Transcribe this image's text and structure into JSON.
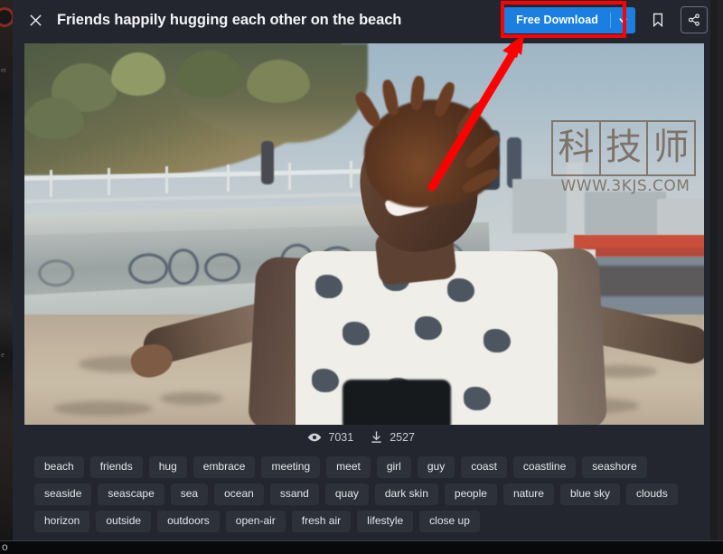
{
  "header": {
    "close_icon": "close-icon",
    "title": "Friends happily hugging each other on the beach",
    "download_label": "Free Download",
    "download_caret_icon": "chevron-down-icon",
    "bookmark_icon": "bookmark-icon",
    "share_icon": "share-icon"
  },
  "photo": {
    "alt": "Man with dreadlocks smiling with arms outstretched on a beach promenade",
    "watermark_chars": [
      "科",
      "技",
      "师"
    ],
    "watermark_url": "WWW.3KJS.COM"
  },
  "annotation": {
    "highlight_color": "#ff0000",
    "arrow_color": "#ff0000",
    "target": "Free Download"
  },
  "stats": {
    "views_icon": "eye-icon",
    "views": "7031",
    "downloads_icon": "download-icon",
    "downloads": "2527"
  },
  "tags": [
    "beach",
    "friends",
    "hug",
    "embrace",
    "meeting",
    "meet",
    "girl",
    "guy",
    "coast",
    "coastline",
    "seashore",
    "seaside",
    "seascape",
    "sea",
    "ocean",
    "ssand",
    "quay",
    "dark skin",
    "people",
    "nature",
    "blue sky",
    "clouds",
    "horizon",
    "outside",
    "outdoors",
    "open-air",
    "fresh air",
    "lifestyle",
    "close up"
  ],
  "backdrop": {
    "left_text_1": "et",
    "left_text_2": "e",
    "bottom_glyph": "o"
  },
  "colors": {
    "modal_bg": "#23262e",
    "accent_blue": "#1a7fe0",
    "tag_bg": "#2d313a",
    "annotation_red": "#ff0000"
  }
}
